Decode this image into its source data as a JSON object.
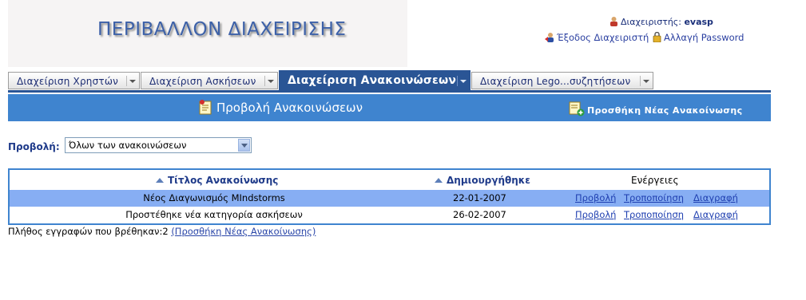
{
  "header": {
    "app_title": "ΠΕΡΙΒΑΛΛΟΝ ΔΙΑΧΕΙΡΙΣΗΣ",
    "admin_label": "Διαχειριστής:",
    "admin_username": "evasp",
    "logout_label": "Έξοδος Διαχειριστή",
    "change_password_label": "Αλλαγή Password"
  },
  "tabs": [
    {
      "label": "Διαχείριση Χρηστών",
      "active": false
    },
    {
      "label": "Διαχείριση Ασκήσεων",
      "active": false
    },
    {
      "label": "Διαχείριση Ανακοινώσεων",
      "active": true
    },
    {
      "label": "Διαχείριση Lego...συζητήσεων",
      "active": false
    }
  ],
  "toolbar": {
    "view_label": "Προβολή Ανακοινώσεων",
    "add_label": "Προσθήκη Νέας Ανακοίνωσης"
  },
  "filter": {
    "label": "Προβολή:",
    "selected": "Όλων των ανακοινώσεων"
  },
  "table": {
    "columns": [
      "Τίτλος Ανακοίνωσης",
      "Δημιουργήθηκε",
      "Ενέργειες"
    ],
    "rows": [
      {
        "title": "Νέος Διαγωνισμός MIndstorms",
        "date": "22-01-2007",
        "selected": true
      },
      {
        "title": "Προστέθηκε νέα κατηγορία ασκήσεων",
        "date": "26-02-2007",
        "selected": false
      }
    ],
    "actions": [
      "Προβολή",
      "Τροποποίηση",
      "Διαγραφή"
    ]
  },
  "footer": {
    "count_text": "Πλήθος εγγραφών που βρέθηκαν:2",
    "add_link": "(Προσθήκη Νέας Ανακοίνωσης)"
  },
  "colors": {
    "accent": "#3f84cf",
    "tab_active": "#2a5595",
    "row_selected": "#87aef3",
    "link": "#1f3fb0"
  },
  "icons": [
    "user-icon",
    "logout-icon",
    "lock-icon",
    "notepad-icon",
    "add-note-icon",
    "sort-asc-icon",
    "chevron-down-icon"
  ]
}
